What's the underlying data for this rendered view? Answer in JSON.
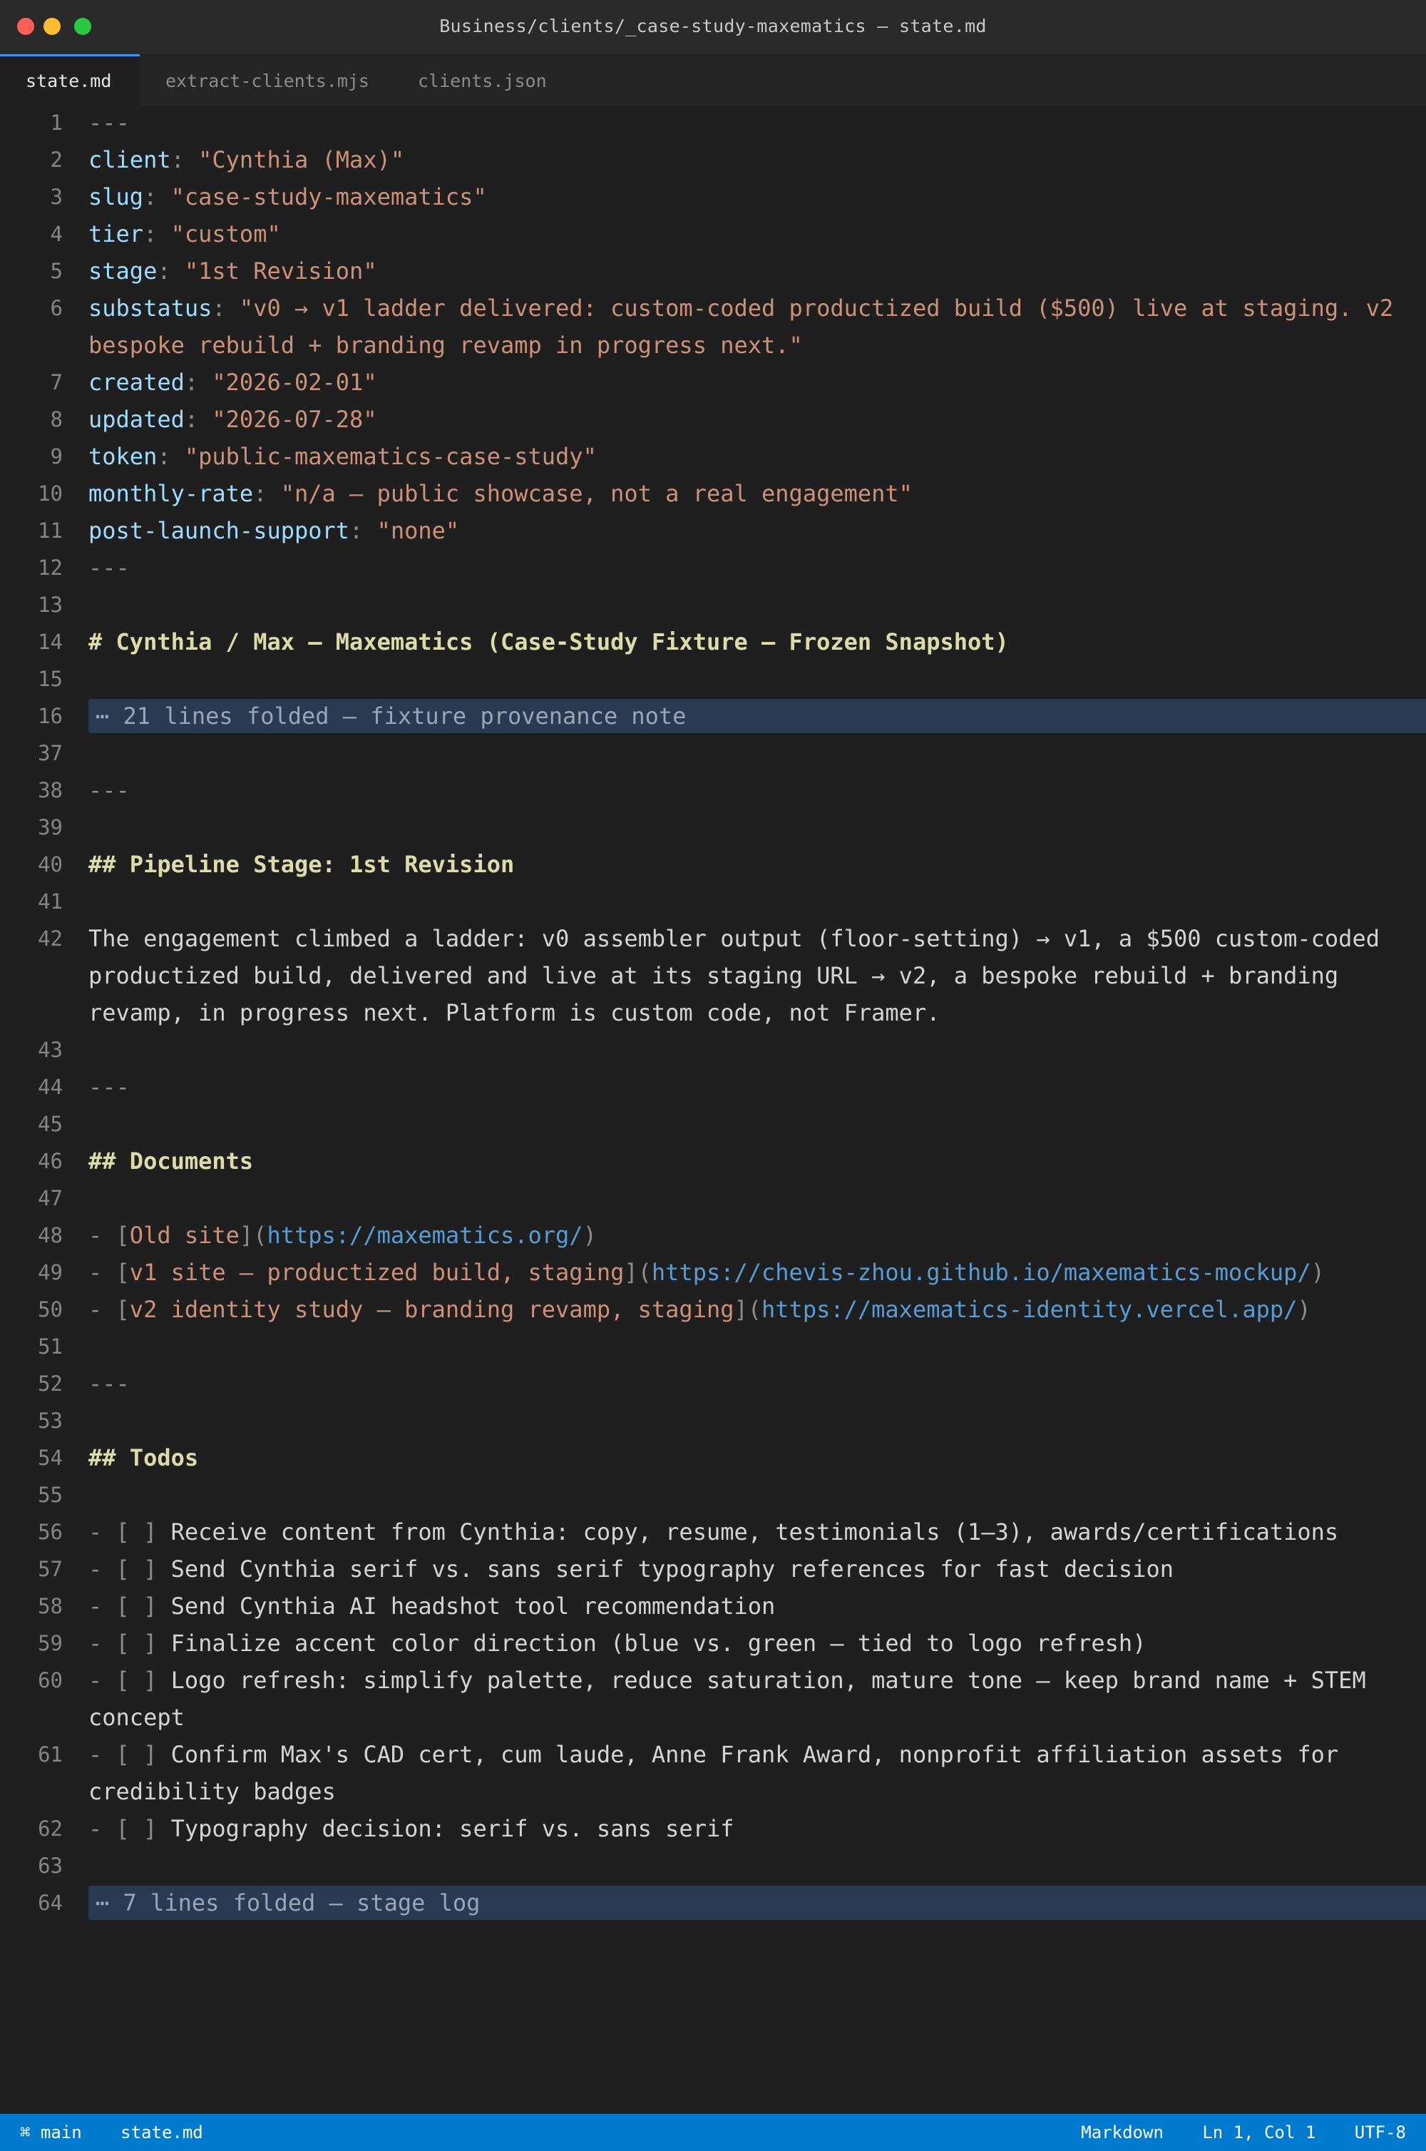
{
  "window": {
    "title": "Business/clients/_case-study-maxematics — state.md"
  },
  "tabs": [
    {
      "label": "state.md"
    },
    {
      "label": "extract-clients.mjs"
    },
    {
      "label": "clients.json"
    }
  ],
  "editor": {
    "frontmatter_delimiter": "---",
    "fm": {
      "client_key": "client",
      "client_val": "\"Cynthia (Max)\"",
      "slug_key": "slug",
      "slug_val": "\"case-study-maxematics\"",
      "tier_key": "tier",
      "tier_val": "\"custom\"",
      "stage_key": "stage",
      "stage_val": "\"1st Revision\"",
      "substatus_key": "substatus",
      "substatus_val": "\"v0 → v1 ladder delivered: custom-coded productized build ($500) live at staging. v2 bespoke rebuild + branding revamp in progress next.\"",
      "created_key": "created",
      "created_val": "\"2026-02-01\"",
      "updated_key": "updated",
      "updated_val": "\"2026-07-28\"",
      "token_key": "token",
      "token_val": "\"public-maxematics-case-study\"",
      "rate_key": "monthly-rate",
      "rate_val": "\"n/a — public showcase, not a real engagement\"",
      "support_key": "post-launch-support",
      "support_val": "\"none\""
    },
    "colon": ": ",
    "h1": "# Cynthia / Max — Maxematics (Case-Study Fixture — Frozen Snapshot)",
    "fold1": "⋯ 21 lines folded — fixture provenance note",
    "h2_pipeline": "## Pipeline Stage: 1st Revision",
    "pipeline_text": "The engagement climbed a ladder: v0 assembler output (floor-setting) → v1, a $500 custom-coded productized build, delivered and live at its staging URL → v2, a bespoke rebuild + branding revamp, in progress next. Platform is custom code, not Framer.",
    "h2_documents": "## Documents",
    "docs": [
      {
        "text": "Old site",
        "url": "https://maxematics.org/"
      },
      {
        "text": "v1 site — productized build, staging",
        "url": "https://chevis-zhou.github.io/maxematics-mockup/"
      },
      {
        "text": "v2 identity study — branding revamp, staging",
        "url": "https://maxematics-identity.vercel.app/"
      }
    ],
    "h2_todos": "## Todos",
    "todo_prefix": "- [ ] ",
    "todos": [
      "Receive content from Cynthia: copy, resume, testimonials (1–3), awards/certifications",
      "Send Cynthia serif vs. sans serif typography references for fast decision",
      "Send Cynthia AI headshot tool recommendation",
      "Finalize accent color direction (blue vs. green — tied to logo refresh)",
      "Logo refresh: simplify palette, reduce saturation, mature tone — keep brand name + STEM concept",
      "Confirm Max's CAD cert, cum laude, Anne Frank Award, nonprofit affiliation assets for credibility badges",
      "Typography decision: serif vs. sans serif"
    ],
    "fold2": "⋯ 7 lines folded — stage log",
    "line_numbers": [
      "1",
      "2",
      "3",
      "4",
      "5",
      "6",
      "7",
      "8",
      "9",
      "10",
      "11",
      "12",
      "13",
      "14",
      "15",
      "16",
      "37",
      "38",
      "39",
      "40",
      "41",
      "42",
      "43",
      "44",
      "45",
      "46",
      "47",
      "48",
      "49",
      "50",
      "51",
      "52",
      "53",
      "54",
      "55",
      "56",
      "57",
      "58",
      "59",
      "60",
      "61",
      "62",
      "63",
      "64"
    ]
  },
  "statusbar": {
    "branch": "⌘ main",
    "file": "state.md",
    "language": "Markdown",
    "cursor": "Ln 1, Col 1",
    "encoding": "UTF-8"
  },
  "colors": {
    "accent": "#007acc",
    "key": "#9cdcfe",
    "string": "#ce9178",
    "heading": "#dcdcaa",
    "link": "#569cd6"
  }
}
